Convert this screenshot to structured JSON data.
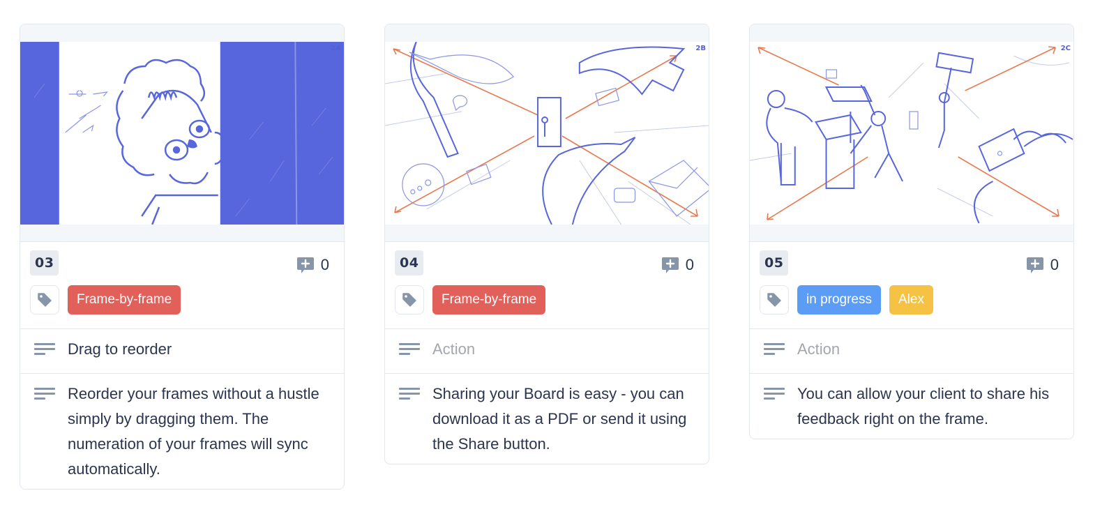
{
  "colors": {
    "tag_red": "#e2605a",
    "tag_blue": "#5b9cf6",
    "tag_yellow": "#f5c244",
    "sketch_blue": "#5160d6",
    "arrow_orange": "#e8794f"
  },
  "cards": [
    {
      "frame_number": "03",
      "scene_label": "2A",
      "comment_count": "0",
      "tags": [
        {
          "label": "Frame-by-frame",
          "color": "#e2605a"
        }
      ],
      "action": {
        "value": "Drag to reorder",
        "placeholder": "Action",
        "is_placeholder": false
      },
      "description": "Reorder your frames without a hustle simply by dragging them. The numeration of your frames will sync automatically.",
      "image_alt": "sketch of curly-haired character peeking around a door"
    },
    {
      "frame_number": "04",
      "scene_label": "2B",
      "comment_count": "0",
      "tags": [
        {
          "label": "Frame-by-frame",
          "color": "#e2605a"
        }
      ],
      "action": {
        "value": "Action",
        "placeholder": "Action",
        "is_placeholder": true
      },
      "description": "Sharing your Board is easy - you can download it as a PDF or send it using the Share button.",
      "image_alt": "sketch of flying speech bubbles and envelopes radiating from a doorway"
    },
    {
      "frame_number": "05",
      "scene_label": "2C",
      "comment_count": "0",
      "tags": [
        {
          "label": "in progress",
          "color": "#5b9cf6"
        },
        {
          "label": "Alex",
          "color": "#f5c244"
        }
      ],
      "action": {
        "value": "Action",
        "placeholder": "Action",
        "is_placeholder": true
      },
      "description": "You can allow your client to share his feedback right on the frame.",
      "image_alt": "sketch of people stacking boxes with floating objects"
    }
  ]
}
